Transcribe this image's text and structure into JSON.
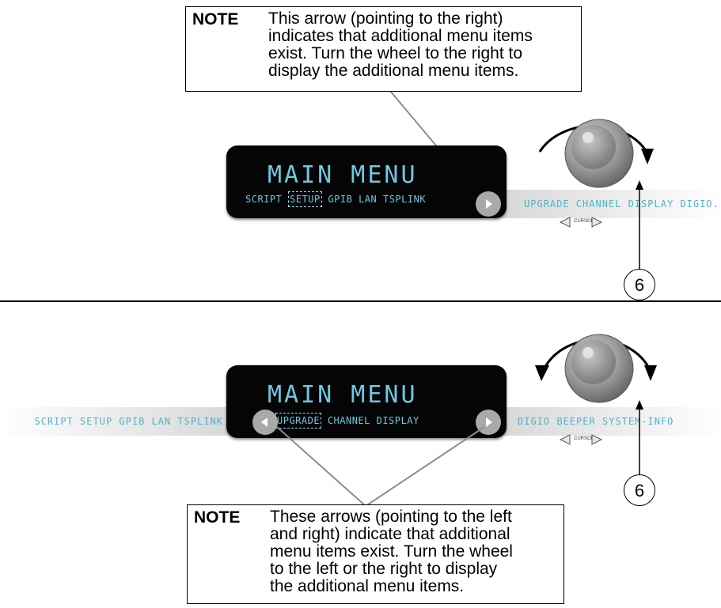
{
  "top_note": {
    "label": "NOTE",
    "lines": [
      "This arrow (pointing to the right)",
      "indicates that additional menu items",
      "exist. Turn the wheel to the right to",
      "display the additional menu items."
    ]
  },
  "bottom_note": {
    "label": "NOTE",
    "lines": [
      "These arrows (pointing to the left",
      "and right) indicate that additional",
      "menu items exist. Turn the wheel",
      "to the left or the right to display",
      "the additional menu items."
    ]
  },
  "top_panel": {
    "title": "MAIN MENU",
    "items_before": "SCRIPT",
    "selected": "SETUP",
    "items_after": "GPIB LAN TSPLINK",
    "ribbon_right": "UPGRADE CHANNEL DISPLAY DIGIO...",
    "cursor_label": "CURSOR",
    "callout": "6"
  },
  "bottom_panel": {
    "title": "MAIN MENU",
    "selected": "UPGRADE",
    "items_after": "CHANNEL DISPLAY",
    "ribbon_left": "SCRIPT SETUP GPIB LAN TSPLINK",
    "ribbon_right": "DIGIO BEEPER SYSTEM-INFO",
    "cursor_label": "CURSOR",
    "callout": "6"
  },
  "colors": {
    "display_text": "#6ec8e0",
    "ribbon_text": "#4fb3c9",
    "display_bg": "#050505"
  },
  "icons": [
    "right-arrow-icon",
    "left-arrow-icon",
    "navigation-wheel-icon",
    "rotation-arrow-icon"
  ]
}
